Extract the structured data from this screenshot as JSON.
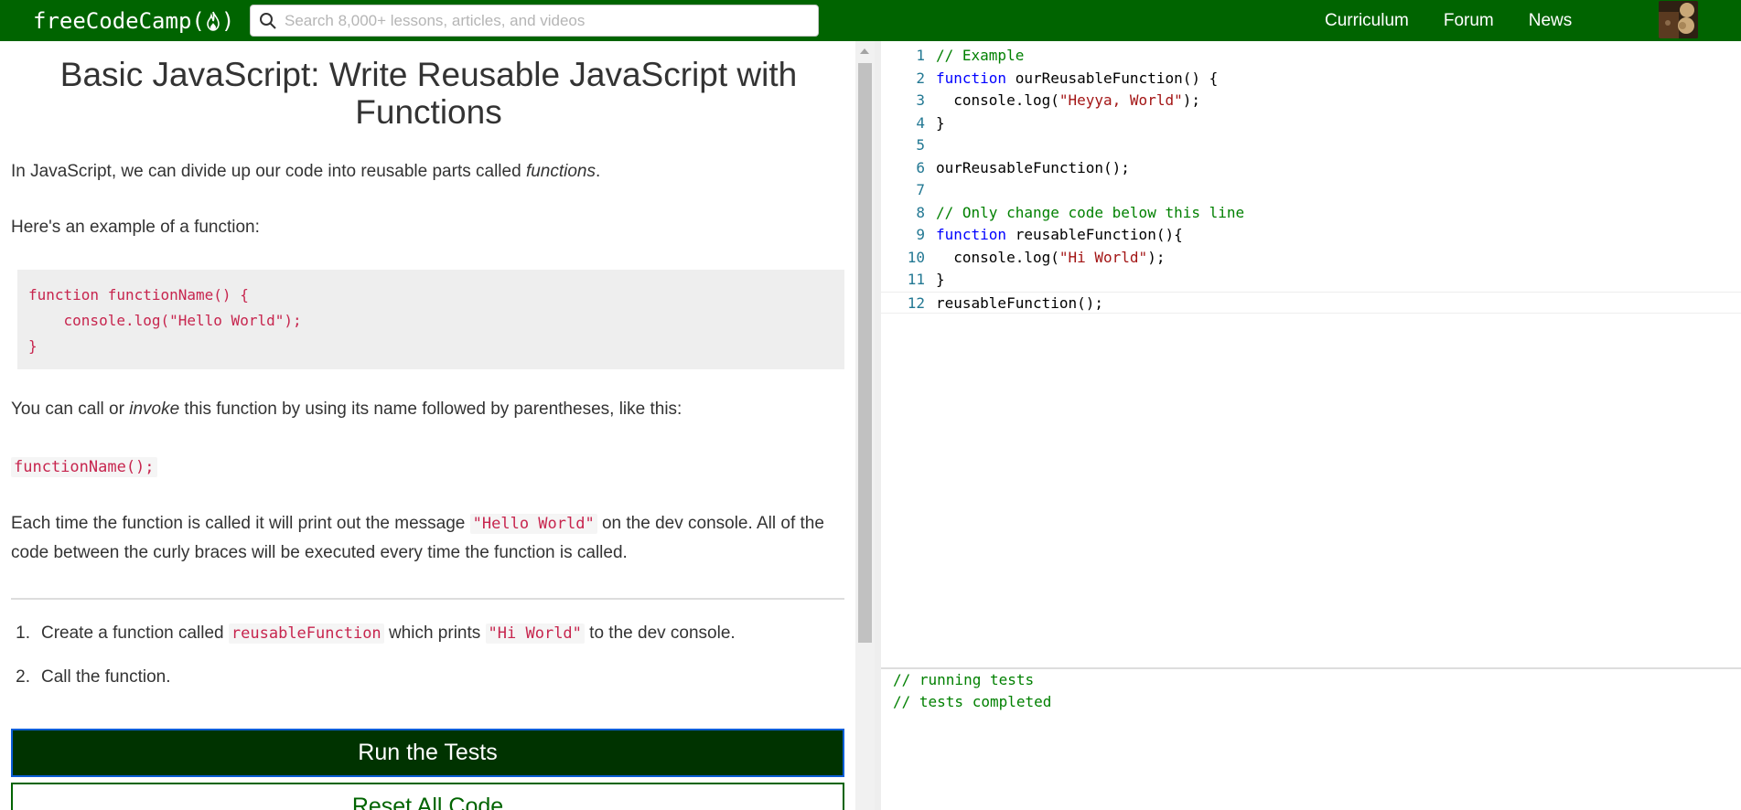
{
  "navbar": {
    "brand_left": "freeCodeCamp(",
    "brand_right": ")",
    "search_placeholder": "Search 8,000+ lessons, articles, and videos",
    "links": [
      "Curriculum",
      "Forum",
      "News"
    ]
  },
  "lesson": {
    "title": "Basic JavaScript: Write Reusable JavaScript with Functions",
    "p1_before": "In JavaScript, we can divide up our code into reusable parts called ",
    "p1_em": "functions",
    "p1_after": ".",
    "p2": "Here's an example of a function:",
    "example_code": "function functionName() {\n    console.log(\"Hello World\");\n}",
    "p3_before": "You can call or ",
    "p3_em": "invoke",
    "p3_after": " this function by using its name followed by parentheses, like this:",
    "call_code": "functionName();",
    "p4_before": "Each time the function is called it will print out the message ",
    "p4_code": "\"Hello World\"",
    "p4_after": " on the dev console. All of the code between the curly braces will be executed every time the function is called.",
    "tasks": [
      {
        "num": "1.",
        "before": "Create a function called ",
        "code1": "reusableFunction",
        "middle": " which prints ",
        "code2": "\"Hi World\"",
        "after": " to the dev console."
      },
      {
        "num": "2.",
        "text": "Call the function."
      }
    ],
    "run_button": "Run the Tests",
    "reset_button": "Reset All Code"
  },
  "editor": {
    "line_numbers": [
      "1",
      "2",
      "3",
      "4",
      "5",
      "6",
      "7",
      "8",
      "9",
      "10",
      "11",
      "12"
    ],
    "lines": [
      [
        {
          "t": "c",
          "v": "// Example"
        }
      ],
      [
        {
          "t": "k",
          "v": "function"
        },
        {
          "t": "p",
          "v": " ourReusableFunction() {"
        }
      ],
      [
        {
          "t": "p",
          "v": "  console.log("
        },
        {
          "t": "s",
          "v": "\"Heyya, World\""
        },
        {
          "t": "p",
          "v": ");"
        }
      ],
      [
        {
          "t": "p",
          "v": "}"
        }
      ],
      [],
      [
        {
          "t": "p",
          "v": "ourReusableFunction();"
        }
      ],
      [],
      [
        {
          "t": "c",
          "v": "// Only change code below this line"
        }
      ],
      [
        {
          "t": "k",
          "v": "function"
        },
        {
          "t": "p",
          "v": " reusableFunction(){"
        }
      ],
      [
        {
          "t": "p",
          "v": "  console.log("
        },
        {
          "t": "s",
          "v": "\"Hi World\""
        },
        {
          "t": "p",
          "v": ");"
        }
      ],
      [
        {
          "t": "p",
          "v": "}"
        }
      ],
      [
        {
          "t": "p",
          "v": "reusableFunction();"
        }
      ]
    ]
  },
  "console": {
    "lines": [
      "// running tests",
      "// tests completed"
    ]
  },
  "colors": {
    "navbar": "#006400",
    "run_button": "#003300",
    "inline_code": "#c7254e",
    "comment": "#008000",
    "keyword": "#0000ff",
    "string": "#a31515"
  }
}
